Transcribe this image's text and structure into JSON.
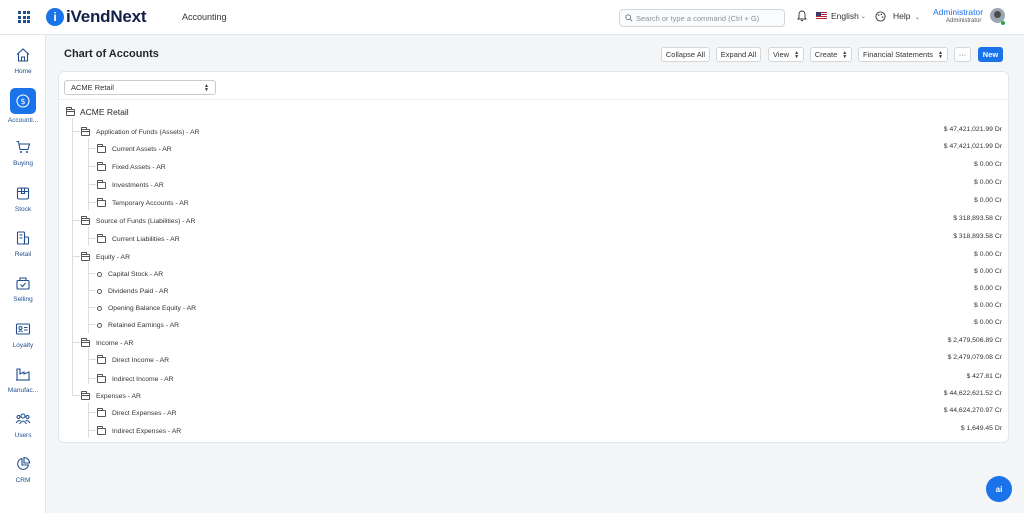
{
  "header": {
    "brand": "iVendNext",
    "brand_mark": "i",
    "module": "Accounting",
    "search_placeholder": "Search or type a command (Ctrl + G)",
    "language": "English",
    "help": "Help",
    "user_name": "Administrator",
    "user_role": "Administrator"
  },
  "sidebar": {
    "items": [
      {
        "label": "Home",
        "icon": "home-icon"
      },
      {
        "label": "Accounti...",
        "icon": "dollar-icon",
        "active": true
      },
      {
        "label": "Buying",
        "icon": "cart-icon"
      },
      {
        "label": "Stock",
        "icon": "box-icon"
      },
      {
        "label": "Retail",
        "icon": "register-icon"
      },
      {
        "label": "Selling",
        "icon": "basket-icon"
      },
      {
        "label": "Loyalty",
        "icon": "card-icon"
      },
      {
        "label": "Manufac...",
        "icon": "factory-icon"
      },
      {
        "label": "Users",
        "icon": "users-icon"
      },
      {
        "label": "CRM",
        "icon": "pie-icon"
      }
    ]
  },
  "page": {
    "title": "Chart of Accounts",
    "buttons": {
      "collapse_all": "Collapse All",
      "expand_all": "Expand All",
      "view": "View",
      "create": "Create",
      "financial_statements": "Financial Statements",
      "more": "···",
      "new": "New"
    },
    "company_select": "ACME Retail",
    "root": "ACME Retail"
  },
  "tree": [
    {
      "label": "Application of Funds (Assets) - AR",
      "amount": "$ 47,421,021.99 Dr"
    },
    {
      "label": "Current Assets - AR",
      "amount": "$ 47,421,021.99 Dr"
    },
    {
      "label": "Fixed Assets - AR",
      "amount": "$ 0.00 Cr"
    },
    {
      "label": "Investments - AR",
      "amount": "$ 0.00 Cr"
    },
    {
      "label": "Temporary Accounts - AR",
      "amount": "$ 0.00 Cr"
    },
    {
      "label": "Source of Funds (Liabilities) - AR",
      "amount": "$ 318,893.58 Cr"
    },
    {
      "label": "Current Liabilities - AR",
      "amount": "$ 318,893.58 Cr"
    },
    {
      "label": "Equity - AR",
      "amount": "$ 0.00 Cr"
    },
    {
      "label": "Capital Stock - AR",
      "amount": "$ 0.00 Cr"
    },
    {
      "label": "Dividends Paid - AR",
      "amount": "$ 0.00 Cr"
    },
    {
      "label": "Opening Balance Equity - AR",
      "amount": "$ 0.00 Cr"
    },
    {
      "label": "Retained Earnings - AR",
      "amount": "$ 0.00 Cr"
    },
    {
      "label": "Income - AR",
      "amount": "$ 2,479,506.89 Cr"
    },
    {
      "label": "Direct Income - AR",
      "amount": "$ 2,479,079.08 Cr"
    },
    {
      "label": "Indirect Income - AR",
      "amount": "$ 427.81 Cr"
    },
    {
      "label": "Expenses - AR",
      "amount": "$ 44,622,621.52 Cr"
    },
    {
      "label": "Direct Expenses - AR",
      "amount": "$ 44,624,270.97 Cr"
    },
    {
      "label": "Indirect Expenses - AR",
      "amount": "$ 1,649.45 Dr"
    }
  ],
  "ai_button": "ai",
  "colors": {
    "accent": "#1a73e8",
    "brand_dark": "#12204a"
  }
}
